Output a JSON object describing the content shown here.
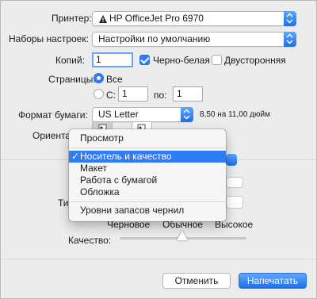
{
  "printer": {
    "label": "Принтер:",
    "value": "HP OfficeJet Pro 6970",
    "icon": "printer-warning-icon"
  },
  "presets": {
    "label": "Наборы настроек:",
    "value": "Настройки по умолчанию"
  },
  "copies": {
    "label": "Копий:",
    "value": "1",
    "bw_label": "Черно-белая",
    "bw_checked": true,
    "duplex_label": "Двусторонняя",
    "duplex_checked": false
  },
  "pages": {
    "label": "Страницы:",
    "all_label": "Все",
    "from_label": "С:",
    "from_value": "1",
    "to_label": "по:",
    "to_value": "1"
  },
  "paper": {
    "label": "Формат бумаги:",
    "value": "US Letter",
    "size_text": "8,50 на 11,00 дюйм"
  },
  "orientation": {
    "label": "Ориентация:"
  },
  "menu": {
    "items": [
      "Просмотр",
      "Носитель и качество",
      "Макет",
      "Работа с бумагой",
      "Обложка",
      "Уровни запасов чернил"
    ],
    "selected": "Носитель и качество",
    "check": "✓"
  },
  "quality": {
    "label": "Качество:",
    "partial_label": "Ти",
    "levels": [
      "Черновое",
      "Обычное",
      "Высокое"
    ],
    "level": "Обычное"
  },
  "footer": {
    "cancel_label": "Отменить",
    "print_label": "Напечатать"
  },
  "colors": {
    "accent": "#2f7cf6",
    "background": "#ececec"
  }
}
